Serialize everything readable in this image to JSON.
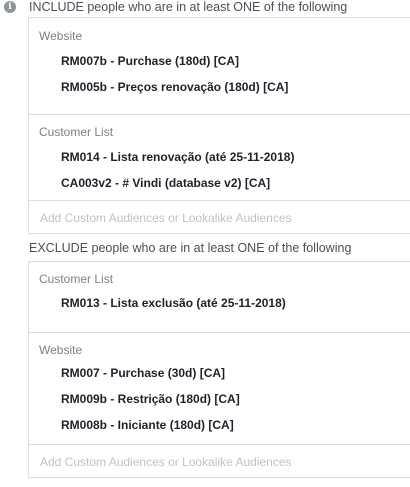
{
  "include": {
    "header": "INCLUDE people who are in at least ONE of the following",
    "groups": [
      {
        "title": "Website",
        "items": [
          "RM007b - Purchase (180d) [CA]",
          "RM005b - Preços renovação (180d) [CA]"
        ]
      },
      {
        "title": "Customer List",
        "items": [
          "RM014 - Lista renovação (até 25-11-2018)",
          "CA003v2 - # Vindi (database v2) [CA]"
        ]
      }
    ],
    "add_placeholder": "Add Custom Audiences or Lookalike Audiences"
  },
  "exclude": {
    "header": "EXCLUDE people who are in at least ONE of the following",
    "groups": [
      {
        "title": "Customer List",
        "items": [
          "RM013 - Lista exclusão (até 25-11-2018)"
        ]
      },
      {
        "title": "Website",
        "items": [
          "RM007 - Purchase (30d) [CA]",
          "RM009b - Restrição (180d) [CA]",
          "RM008b - Iniciante (180d) [CA]"
        ]
      }
    ],
    "add_placeholder": "Add Custom Audiences or Lookalike Audiences"
  },
  "icons": {
    "info": "info-icon"
  }
}
